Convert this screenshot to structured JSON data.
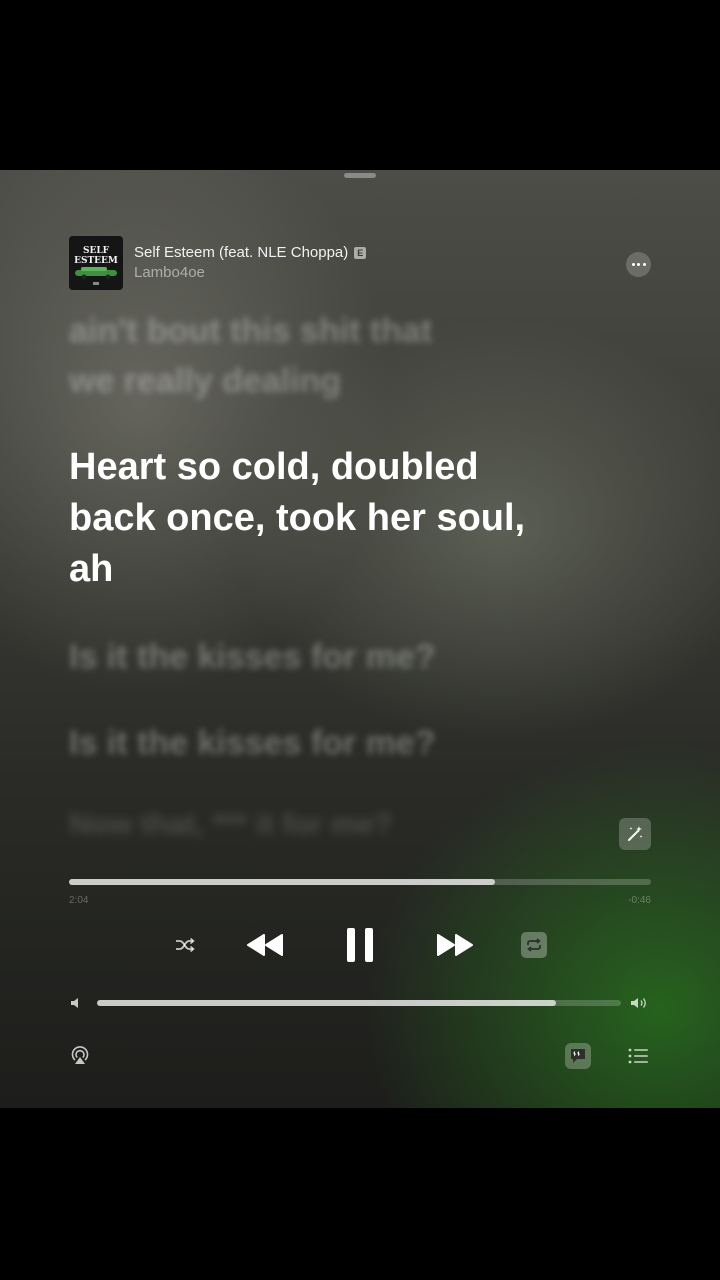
{
  "now_playing": {
    "title": "Self Esteem (feat. NLE Choppa)",
    "explicit_badge": "E",
    "artist": "Lambo4oe",
    "artwork_text": [
      "SELF",
      "ESTEEM"
    ]
  },
  "lyrics": {
    "previous_lines": [
      "ain't bout this shit that",
      "we really dealing"
    ],
    "current_line": [
      "Heart so cold, doubled",
      "back once, took her soul,",
      "ah"
    ],
    "upcoming_lines": [
      "Is it the kisses for me?",
      "Is it the kisses for me?",
      "Now that, *** it for me?"
    ]
  },
  "playback": {
    "progress": 0.732,
    "elapsed": "2:04",
    "remaining": "-0:46",
    "volume": 0.876
  },
  "colors": {
    "background_top": "#4c4d46",
    "background_bottom": "#1d1e1b",
    "accent_glow": "#28781e"
  },
  "icons": {
    "more": "ellipsis-icon",
    "magic": "magic-wand-icon",
    "shuffle": "shuffle-icon",
    "rewind": "rewind-icon",
    "pause": "pause-icon",
    "forward": "fast-forward-icon",
    "repeat": "repeat-icon",
    "volume_low": "speaker-low-icon",
    "volume_high": "speaker-high-icon",
    "airplay": "airplay-icon",
    "lyrics": "lyrics-bubble-icon",
    "queue": "list-icon"
  }
}
